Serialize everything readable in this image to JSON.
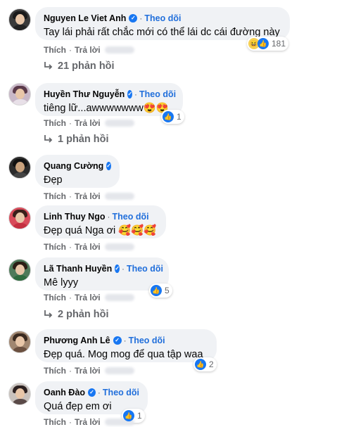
{
  "labels": {
    "follow": "Theo dõi",
    "like": "Thích",
    "reply": "Trả lời",
    "dot": "·"
  },
  "comments": [
    {
      "name": "Nguyen Le Viet Anh",
      "text": "Tay lái phải rất chắc mới có thể lái dc cái đường này",
      "reaction_count": "181",
      "reactions": [
        "haha",
        "like"
      ],
      "replies": "21 phản hồi",
      "follow": true
    },
    {
      "name": "Huyền Thư Nguyễn",
      "text": "tiêng lữ...awwwwwww😍😍",
      "reaction_count": "1",
      "reactions": [
        "like"
      ],
      "replies": "1 phản hồi",
      "follow": true
    },
    {
      "name": "Quang Cường",
      "text": "Đẹp",
      "follow": false
    },
    {
      "name": "Linh Thuy Ngo",
      "text": "Đẹp quá Nga ơi 🥰🥰🥰",
      "follow": true
    },
    {
      "name": "Lã Thanh Huyền",
      "text": "Mê lyyy",
      "reaction_count": "5",
      "reactions": [
        "like"
      ],
      "replies": "2 phản hồi",
      "follow": true
    },
    {
      "name": "Phương Anh Lê",
      "text": "Đẹp quá. Mog mog để qua tập waa",
      "reaction_count": "2",
      "reactions": [
        "like"
      ],
      "follow": true
    },
    {
      "name": "Oanh Đào",
      "text": "Quá đẹp em ơi",
      "reaction_count": "1",
      "reactions": [
        "like"
      ],
      "follow": true
    }
  ],
  "colors": {
    "bubble": "#f0f2f5",
    "link": "#216fdb",
    "verified": "#1877f2",
    "secondary": "#65676b"
  }
}
